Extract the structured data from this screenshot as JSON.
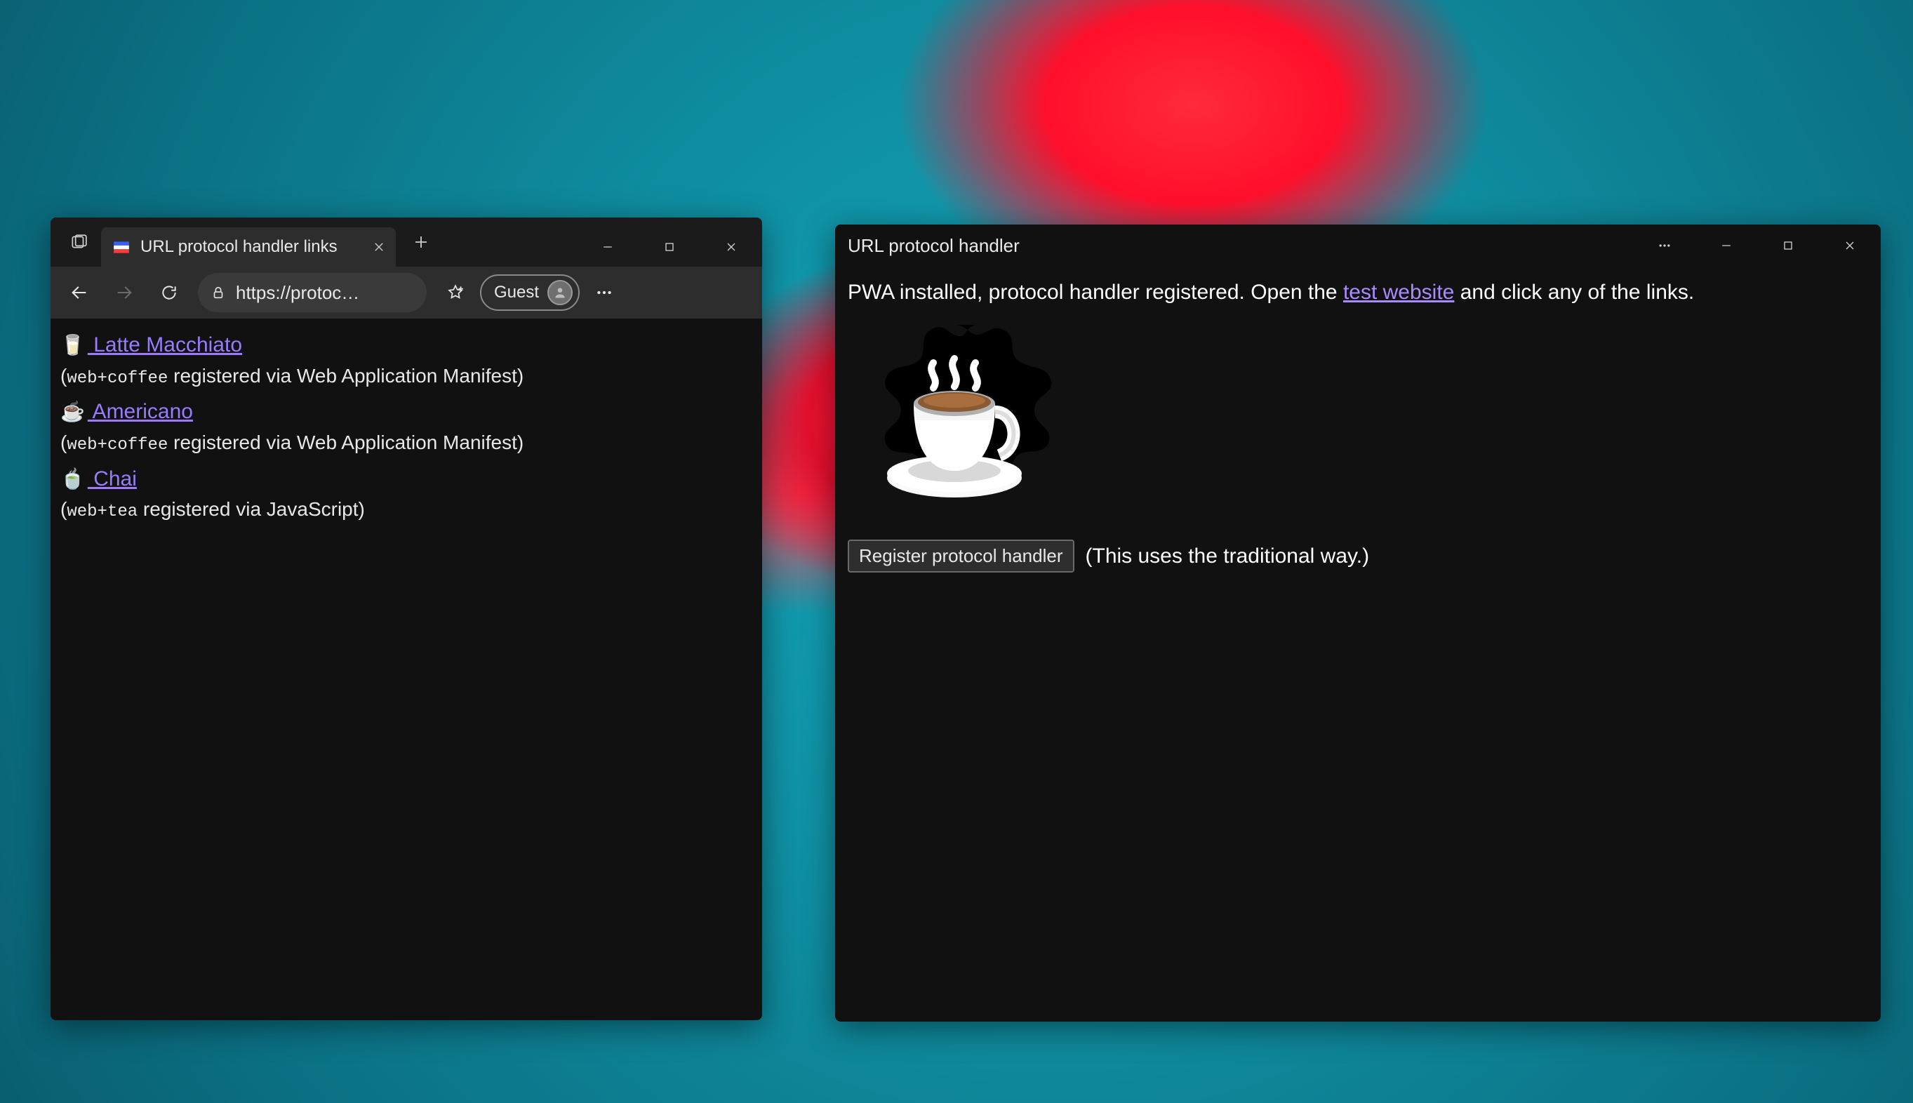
{
  "browser": {
    "tab": {
      "title": "URL protocol handler links"
    },
    "omnibox": {
      "url": "https://protoc…"
    },
    "profile": {
      "label": "Guest"
    },
    "page": {
      "items": [
        {
          "emoji": "🥛",
          "label": " Latte Macchiato",
          "sub_prefix": "(",
          "sub_mono": "web+coffee",
          "sub_rest": " registered via Web Application Manifest)"
        },
        {
          "emoji": "☕",
          "label": " Americano",
          "sub_prefix": "(",
          "sub_mono": "web+coffee",
          "sub_rest": " registered via Web Application Manifest)"
        },
        {
          "emoji": "🍵",
          "label": " Chai",
          "sub_prefix": "(",
          "sub_mono": "web+tea",
          "sub_rest": " registered via JavaScript)"
        }
      ]
    }
  },
  "pwa": {
    "title": "URL protocol handler",
    "intro_before": "PWA installed, protocol handler registered. Open the ",
    "intro_link": "test website",
    "intro_after": " and click any of the links.",
    "register_button": "Register protocol handler",
    "register_note": "(This uses the traditional way.)"
  }
}
